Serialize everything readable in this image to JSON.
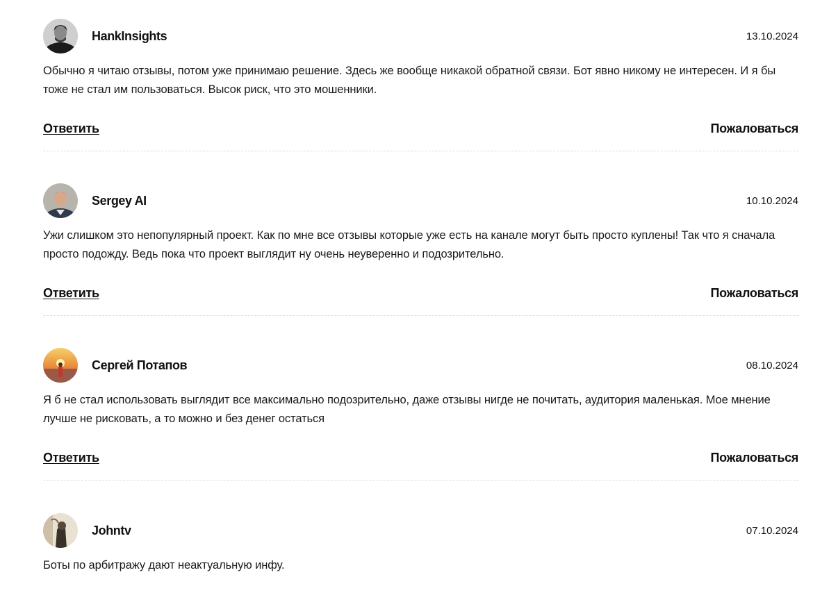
{
  "reviews": [
    {
      "author": "HankInsights",
      "date": "13.10.2024",
      "text": "Обычно я читаю отзывы, потом уже принимаю решение. Здесь же вообще никакой обратной связи. Бот явно никому не интересен. И я бы тоже не стал им пользоваться. Высок риск, что это мошенники.",
      "reply_label": "Ответить",
      "report_label": "Пожаловаться",
      "avatar_icon": "user-photo-icon"
    },
    {
      "author": "Sergey AI",
      "date": "10.10.2024",
      "text": "Ужи слишком это непопулярный проект. Как по мне все отзывы которые уже есть на канале могут быть просто куплены! Так что я сначала просто подожду. Ведь пока что проект выглядит ну очень неуверенно и подозрительно.",
      "reply_label": "Ответить",
      "report_label": "Пожаловаться",
      "avatar_icon": "user-photo-icon"
    },
    {
      "author": "Сергей Потапов",
      "date": "08.10.2024",
      "text": "Я б не стал использовать выглядит все максимально подозрительно, даже отзывы нигде не почитать, аудитория маленькая. Мое мнение лучше не рисковать, а то можно и без денег остаться",
      "reply_label": "Ответить",
      "report_label": "Пожаловаться",
      "avatar_icon": "user-photo-icon"
    },
    {
      "author": "Johntv",
      "date": "07.10.2024",
      "text": "Боты по арбитражу дают неактуальную инфу.",
      "avatar_icon": "user-photo-icon"
    }
  ]
}
